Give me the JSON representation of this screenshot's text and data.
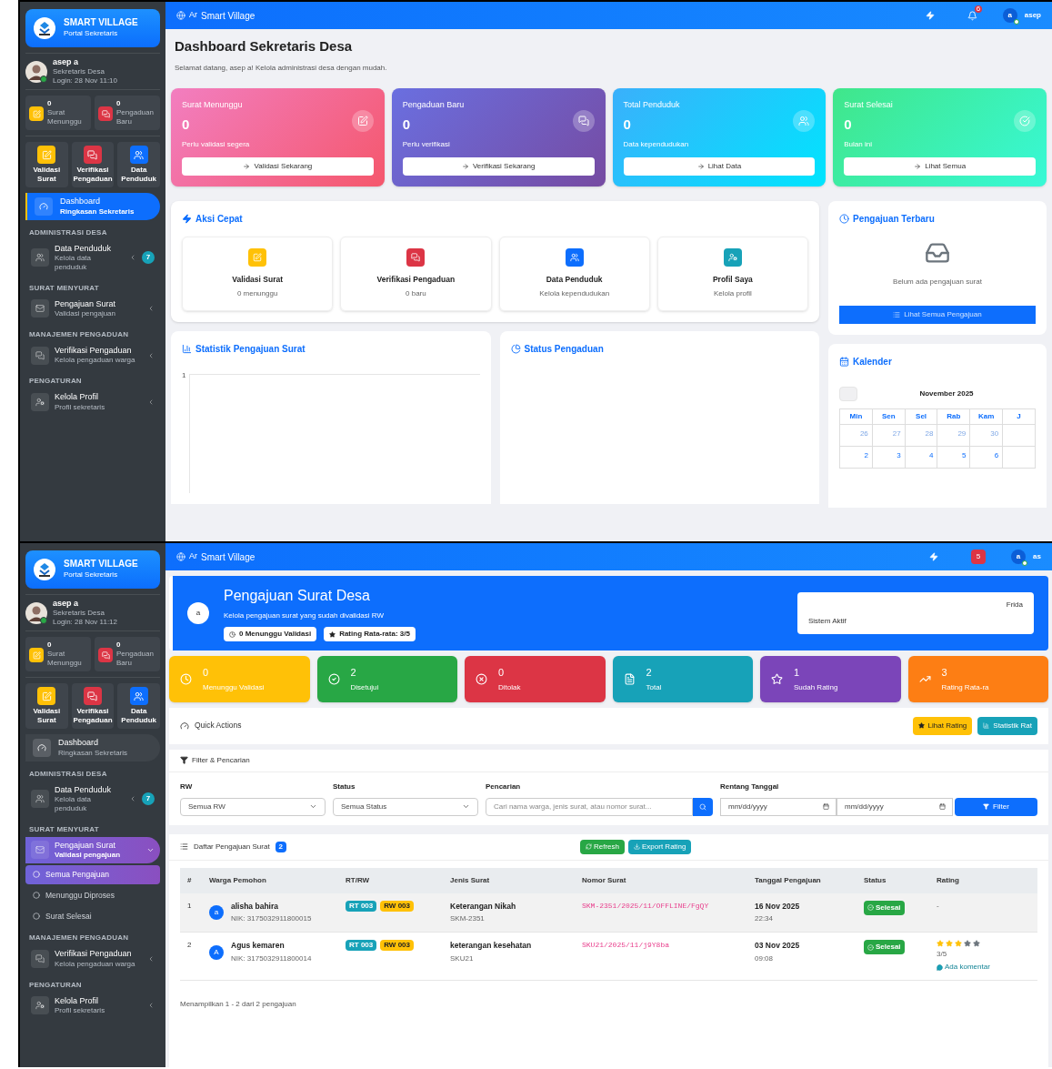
{
  "dashboard_screen": {
    "sidebar": {
      "brand": "SMART VILLAGE",
      "brand_note": "Portal Sekretaris",
      "user_name": "asep a",
      "user_role": "Sekretaris Desa",
      "user_login": "Login: 28 Nov 11:10",
      "stats": [
        {
          "value": "0",
          "label": "Surat Menunggu",
          "color": "#ffc107"
        },
        {
          "value": "0",
          "label": "Pengaduan Baru",
          "color": "#dc3545"
        }
      ],
      "tiles": [
        {
          "label": "Validasi Surat",
          "color": "#ffc107"
        },
        {
          "label": "Verifikasi Pengaduan",
          "color": "#dc3545"
        },
        {
          "label": "Data Penduduk",
          "color": "#0d6efd"
        }
      ],
      "dashboard_link": {
        "label": "Dashboard",
        "note": "Ringkasan Sekretaris",
        "selected": true
      },
      "sections": [
        {
          "title": "ADMINISTRASI DESA",
          "items": [
            {
              "label": "Data Penduduk",
              "note": "Kelola data penduduk",
              "badge": "7",
              "selected": false,
              "expanded": false
            }
          ]
        },
        {
          "title": "SURAT MENYURAT",
          "items": [
            {
              "label": "Pengajuan Surat",
              "note": "Validasi pengajuan",
              "selected": false,
              "expanded": false
            }
          ]
        },
        {
          "title": "MANAJEMEN PENGADUAN",
          "items": [
            {
              "label": "Verifikasi Pengaduan",
              "note": "Kelola pengaduan warga",
              "selected": false,
              "expanded": false
            }
          ]
        },
        {
          "title": "PENGATURAN",
          "items": [
            {
              "label": "Kelola Profil",
              "note": "Profil sekretaris",
              "selected": false,
              "expanded": false
            }
          ]
        }
      ]
    },
    "topbar": {
      "logo_alt": "Ar",
      "brand": "Smart Village",
      "notification_count": "6",
      "user_initial": "a",
      "user_name": "asep"
    },
    "page": {
      "title": "Dashboard Sekretaris Desa",
      "subtitle": "Selamat datang, asep a! Kelola administrasi desa dengan mudah."
    },
    "stat_cards": [
      {
        "label": "Surat Menunggu",
        "value": "0",
        "note": "Perlu validasi segera",
        "action": "Validasi Sekarang",
        "color": "#f27ec0"
      },
      {
        "label": "Pengaduan Baru",
        "value": "0",
        "note": "Perlu verifikasi",
        "action": "Verifikasi Sekarang",
        "color": "#6a6fe0"
      },
      {
        "label": "Total Penduduk",
        "value": "0",
        "note": "Data kependudukan",
        "action": "Lihat Data",
        "color": "#3ab0fb"
      },
      {
        "label": "Surat Selesai",
        "value": "0",
        "note": "Bulan ini",
        "action": "Lihat Semua",
        "color": "#40e68a"
      }
    ],
    "quick_actions": {
      "title": "Aksi Cepat",
      "items": [
        {
          "label": "Validasi Surat",
          "note": "0 menunggu",
          "color": "#ffc107"
        },
        {
          "label": "Verifikasi Pengaduan",
          "note": "0 baru",
          "color": "#dc3545"
        },
        {
          "label": "Data Penduduk",
          "note": "Kelola kependudukan",
          "color": "#0d6efd"
        },
        {
          "label": "Profil Saya",
          "note": "Kelola profil",
          "color": "#17a2b8"
        }
      ]
    },
    "recent": {
      "title": "Pengajuan Terbaru",
      "empty_text": "Belum ada pengajuan surat",
      "action": "Lihat Semua Pengajuan"
    },
    "statistics": {
      "title": "Statistik Pengajuan Surat",
      "y_tick": "1"
    },
    "complaint_status": {
      "title": "Status Pengaduan"
    },
    "calendar": {
      "title": "Kalender",
      "month": "November 2025",
      "weekdays": [
        "Min",
        "Sen",
        "Sel",
        "Rab",
        "Kam",
        "J"
      ],
      "weeks": [
        [
          {
            "day": "26",
            "outside": true
          },
          {
            "day": "27",
            "outside": true
          },
          {
            "day": "28",
            "outside": true
          },
          {
            "day": "29",
            "outside": true
          },
          {
            "day": "30",
            "outside": true
          }
        ],
        [
          {
            "day": "2",
            "outside": false
          },
          {
            "day": "3",
            "outside": false
          },
          {
            "day": "4",
            "outside": false
          },
          {
            "day": "5",
            "outside": false
          },
          {
            "day": "6",
            "outside": false
          }
        ]
      ]
    }
  },
  "pengajuan_screen": {
    "sidebar": {
      "brand": "SMART VILLAGE",
      "brand_note": "Portal Sekretaris",
      "user_name": "asep a",
      "user_role": "Sekretaris Desa",
      "user_login": "Login: 28 Nov 11:12",
      "stats": [
        {
          "value": "0",
          "label": "Surat Menunggu",
          "color": "#ffc107"
        },
        {
          "value": "0",
          "label": "Pengaduan Baru",
          "color": "#dc3545"
        }
      ],
      "tiles": [
        {
          "label": "Validasi Surat",
          "color": "#ffc107"
        },
        {
          "label": "Verifikasi Pengaduan",
          "color": "#dc3545"
        },
        {
          "label": "Data Penduduk",
          "color": "#0d6efd"
        }
      ],
      "dashboard_link": {
        "label": "Dashboard",
        "note": "Ringkasan Sekretaris",
        "selected": false
      },
      "sections": [
        {
          "title": "ADMINISTRASI DESA",
          "items": [
            {
              "label": "Data Penduduk",
              "note": "Kelola data penduduk",
              "badge": "7",
              "selected": false,
              "expanded": false
            }
          ]
        },
        {
          "title": "SURAT MENYURAT",
          "items": [
            {
              "label": "Pengajuan Surat",
              "note": "Validasi pengajuan",
              "selected": true,
              "expanded": true,
              "children": [
                {
                  "label": "Semua Pengajuan",
                  "selected": true
                },
                {
                  "label": "Menunggu Diproses",
                  "selected": false
                },
                {
                  "label": "Surat Selesai",
                  "selected": false
                }
              ]
            }
          ]
        },
        {
          "title": "MANAJEMEN PENGADUAN",
          "items": [
            {
              "label": "Verifikasi Pengaduan",
              "note": "Kelola pengaduan warga",
              "selected": false,
              "expanded": false
            }
          ]
        },
        {
          "title": "PENGATURAN",
          "items": [
            {
              "label": "Kelola Profil",
              "note": "Profil sekretaris",
              "selected": false,
              "expanded": false
            }
          ]
        }
      ]
    },
    "topbar": {
      "logo_alt": "Ar",
      "brand": "Smart Village",
      "notification_count": "5",
      "user_initial": "a",
      "user_name": "as"
    },
    "header": {
      "avatar": "a",
      "title": "Pengajuan Surat Desa",
      "subtitle": "Kelola pengajuan surat yang sudah divalidasi RW",
      "badges": [
        "0 Menunggu Validasi",
        "Rating Rata-rata: 3/5"
      ],
      "status_day": "Frida",
      "status_text": "Sistem Aktif"
    },
    "stat_cards": [
      {
        "value": "0",
        "label": "Menunggu Validasi",
        "color": "#ffc107"
      },
      {
        "value": "2",
        "label": "Disetujui",
        "color": "#28a745"
      },
      {
        "value": "0",
        "label": "Ditolak",
        "color": "#dc3545"
      },
      {
        "value": "2",
        "label": "Total",
        "color": "#17a2b8"
      },
      {
        "value": "1",
        "label": "Sudah Rating",
        "color": "#7b45b9"
      },
      {
        "value": "3",
        "label": "Rating Rata-ra",
        "color": "#fd7e14"
      }
    ],
    "quick_actions": {
      "title": "Quick Actions",
      "buttons": [
        {
          "label": "Lihat Rating",
          "color": "#ffc107"
        },
        {
          "label": "Statistik Rat",
          "color": "#17a2b8"
        }
      ]
    },
    "filter": {
      "title": "Filter & Pencarian",
      "fields": [
        {
          "kind": "select",
          "label": "RW",
          "value": "Semua RW"
        },
        {
          "kind": "select",
          "label": "Status",
          "value": "Semua Status"
        },
        {
          "kind": "search",
          "label": "Pencarian",
          "placeholder": "Cari nama warga, jenis surat, atau nomor surat..."
        },
        {
          "kind": "date_range",
          "label": "Rentang Tanggal",
          "from_placeholder": "mm/dd/yyyy",
          "to_placeholder": "mm/dd/yyyy"
        }
      ],
      "submit": "Filter"
    },
    "list": {
      "title": "Daftar Pengajuan Surat",
      "count": "2",
      "buttons": [
        "Refresh",
        "Export Rating"
      ],
      "columns": [
        "#",
        "Warga Pemohon",
        "RT/RW",
        "Jenis Surat",
        "Nomor Surat",
        "Tanggal Pengajuan",
        "Status",
        "Rating"
      ],
      "rows": [
        {
          "number": "1",
          "initial": "a",
          "name": "alisha bahira",
          "nik": "NIK: 3175032911800015",
          "rt": "RT 003",
          "rw": "RW 003",
          "letter_type": "Keterangan Nikah",
          "letter_code": "SKM-2351",
          "letter_number": "SKM-2351/2025/11/OFFLINE/FgQY",
          "date": "16 Nov 2025",
          "time": "22:34",
          "status": "Selesai",
          "rating": {
            "kind": "none",
            "text": "-"
          }
        },
        {
          "number": "2",
          "initial": "A",
          "name": "Agus kemaren",
          "nik": "NIK: 3175032911800014",
          "rt": "RT 003",
          "rw": "RW 003",
          "letter_type": "keterangan kesehatan",
          "letter_code": "SKU21",
          "letter_number": "SKU21/2025/11/j9Y8ba",
          "date": "03 Nov 2025",
          "time": "09:08",
          "status": "Selesai",
          "rating": {
            "kind": "stars",
            "stars": 3,
            "score": "3/5",
            "comment": "Ada komentar"
          }
        }
      ],
      "footer": "Menampilkan 1 - 2 dari 2 pengajuan"
    }
  }
}
